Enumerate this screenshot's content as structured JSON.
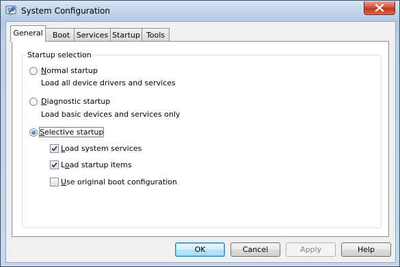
{
  "window": {
    "title": "System Configuration"
  },
  "tabs": [
    {
      "label": "General",
      "active": true
    },
    {
      "label": "Boot",
      "active": false
    },
    {
      "label": "Services",
      "active": false
    },
    {
      "label": "Startup",
      "active": false
    },
    {
      "label": "Tools",
      "active": false
    }
  ],
  "startup_selection": {
    "legend": "Startup selection",
    "options": [
      {
        "label": "Normal startup",
        "description": "Load all device drivers and services",
        "selected": false
      },
      {
        "label": "Diagnostic startup",
        "description": "Load basic devices and services only",
        "selected": false
      },
      {
        "label": "Selective startup",
        "description": "",
        "selected": true
      }
    ],
    "selective_items": [
      {
        "label": "Load system services",
        "checked": true
      },
      {
        "label": "Load startup items",
        "checked": true
      },
      {
        "label": "Use original boot configuration",
        "checked": false
      }
    ]
  },
  "buttons": {
    "ok": "OK",
    "cancel": "Cancel",
    "apply": "Apply",
    "help": "Help"
  },
  "colors": {
    "title_bar": "#c2d5ea",
    "close_button": "#c0351f",
    "radio_selected": "#2a6ac0",
    "default_button_border": "#3c7fb1"
  },
  "icons": {
    "app": "system-configuration-icon",
    "close": "close-icon",
    "check": "checkmark-icon"
  }
}
